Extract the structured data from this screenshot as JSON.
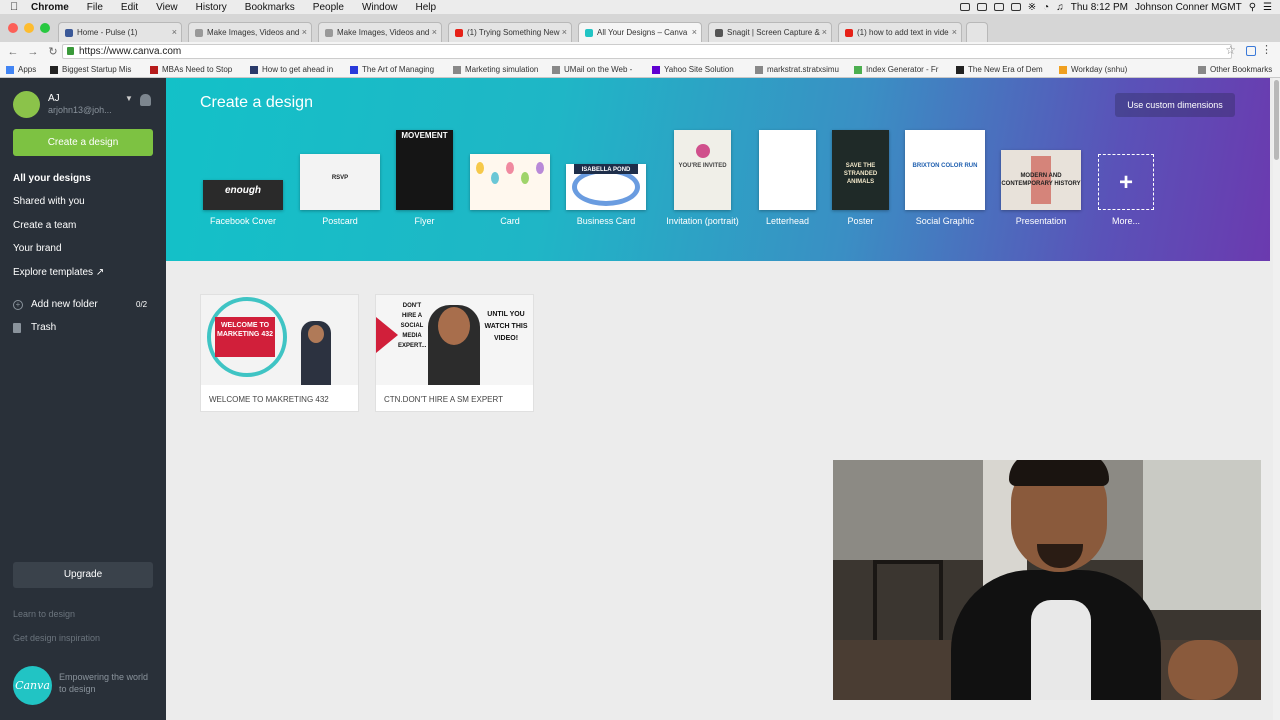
{
  "macos": {
    "menu": [
      "Chrome",
      "File",
      "Edit",
      "View",
      "History",
      "Bookmarks",
      "People",
      "Window",
      "Help"
    ],
    "clock": "Thu 8:12 PM",
    "user": "Johnson Conner MGMT"
  },
  "browser": {
    "tabs": [
      {
        "title": "Home - Pulse (1)",
        "color": "#3b5998"
      },
      {
        "title": "Make Images, Videos and",
        "color": "#999999"
      },
      {
        "title": "Make Images, Videos and",
        "color": "#999999"
      },
      {
        "title": "(1) Trying Something New",
        "color": "#e62117"
      },
      {
        "title": "All Your Designs – Canva",
        "color": "#21c4c4"
      },
      {
        "title": "Snagit | Screen Capture &",
        "color": "#555555"
      },
      {
        "title": "(1) how to add text in vide",
        "color": "#e62117"
      }
    ],
    "url": "https://www.canva.com",
    "bookmarks": [
      {
        "label": "Apps",
        "color": "#4285f4"
      },
      {
        "label": "Biggest Startup Mis",
        "color": "#222222"
      },
      {
        "label": "MBAs Need to Stop",
        "color": "#b71c1c"
      },
      {
        "label": "How to get ahead in",
        "color": "#2a3a6a"
      },
      {
        "label": "The Art of Managing",
        "color": "#2a3adb"
      },
      {
        "label": "Marketing simulation",
        "color": "#888888"
      },
      {
        "label": "UMail on the Web -",
        "color": "#888888"
      },
      {
        "label": "Yahoo Site Solution",
        "color": "#5f01d1"
      },
      {
        "label": "markstrat.stratxsimu",
        "color": "#888888"
      },
      {
        "label": "Index Generator - Fr",
        "color": "#4caf50"
      },
      {
        "label": "The New Era of Dem",
        "color": "#222222"
      },
      {
        "label": "Workday (snhu)",
        "color": "#f0a020"
      },
      {
        "label": "Other Bookmarks",
        "color": "#888888"
      }
    ]
  },
  "sidebar": {
    "user_name": "AJ",
    "user_email": "arjohn13@joh...",
    "create_button": "Create a design",
    "nav": [
      "All your designs",
      "Shared with you",
      "Create a team",
      "Your brand",
      "Explore templates ↗"
    ],
    "add_folder": "Add new folder",
    "folder_count": "0/2",
    "trash": "Trash",
    "upgrade": "Upgrade",
    "learn": "Learn to design",
    "inspiration": "Get design inspiration",
    "logo_text": "Canva",
    "tagline": "Empowering the world to design"
  },
  "banner": {
    "title": "Create a design",
    "custom_button": "Use custom dimensions",
    "templates": [
      {
        "label": "Facebook Cover",
        "thumb_text": "enough",
        "bg": "#2a2a2a",
        "fg": "#ffffff"
      },
      {
        "label": "Postcard",
        "thumb_text": "RSVP",
        "bg": "#f3f3f3",
        "fg": "#222222"
      },
      {
        "label": "Flyer",
        "thumb_text": "MOVEMENT",
        "bg": "#151515",
        "fg": "#ffffff"
      },
      {
        "label": "Card",
        "thumb_text": "",
        "bg": "#fff8ee",
        "fg": "#555555"
      },
      {
        "label": "Business Card",
        "thumb_text": "ISABELLA POND",
        "bg": "#ffffff",
        "fg": "#ffffff"
      },
      {
        "label": "Invitation (portrait)",
        "thumb_text": "YOU'RE INVITED",
        "bg": "#f0efe8",
        "fg": "#444444"
      },
      {
        "label": "Letterhead",
        "thumb_text": "",
        "bg": "#ffffff",
        "fg": "#444444"
      },
      {
        "label": "Poster",
        "thumb_text": "SAVE THE STRANDED ANIMALS",
        "bg": "#1f2a28",
        "fg": "#f0e6c8"
      },
      {
        "label": "Social Graphic",
        "thumb_text": "BRIXTON COLOR RUN",
        "bg": "#ffffff",
        "fg": "#2060b0"
      },
      {
        "label": "Presentation",
        "thumb_text": "MODERN AND CONTEMPORARY HISTORY",
        "bg": "#e8e2da",
        "fg": "#222222"
      },
      {
        "label": "More...",
        "thumb_text": "+",
        "bg": "transparent",
        "fg": "#ffffff"
      }
    ]
  },
  "designs": [
    {
      "name": "WELCOME TO MAKRETING 432",
      "thumb_text": "WELCOME TO MARKETING 432"
    },
    {
      "name": "CTN.DON'T HIRE A SM EXPERT",
      "thumb_text_left": "DON'T HIRE A SOCIAL MEDIA EXPERT...",
      "thumb_text_right": "UNTIL YOU WATCH THIS VIDEO!"
    }
  ]
}
